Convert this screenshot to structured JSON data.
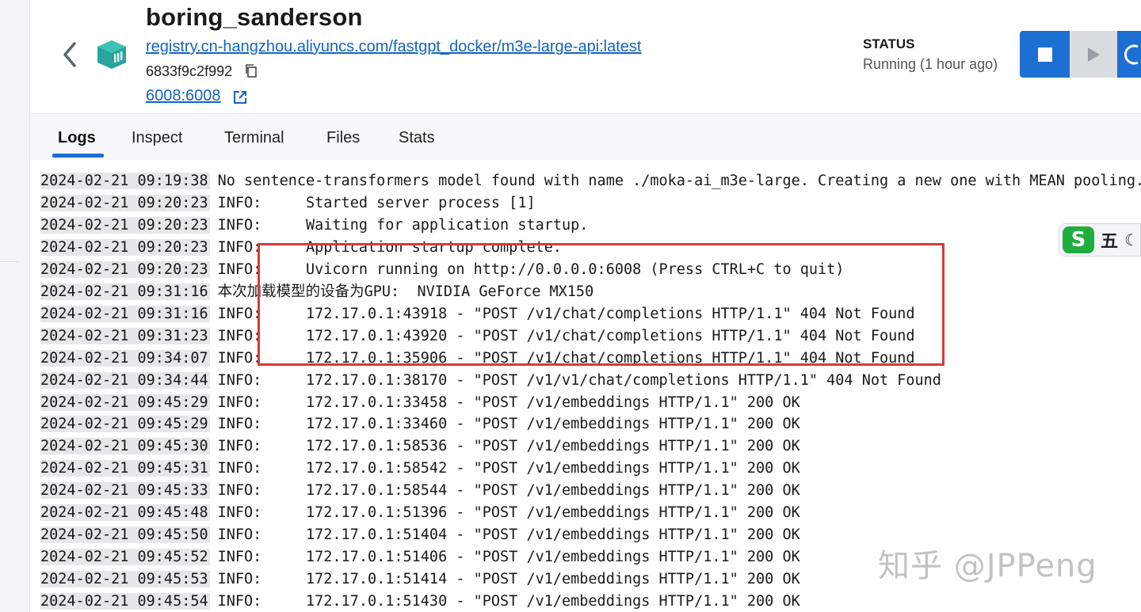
{
  "container": {
    "name": "boring_sanderson",
    "image": "registry.cn-hangzhou.aliyuncs.com/fastgpt_docker/m3e-large-api:latest",
    "id": "6833f9c2f992",
    "port": "6008:6008"
  },
  "status": {
    "label": "STATUS",
    "value": "Running (1 hour ago)"
  },
  "tabs": [
    {
      "label": "Logs",
      "active": true
    },
    {
      "label": "Inspect",
      "active": false
    },
    {
      "label": "Terminal",
      "active": false
    },
    {
      "label": "Files",
      "active": false
    },
    {
      "label": "Stats",
      "active": false
    }
  ],
  "logs": [
    {
      "ts": "2024-02-21 09:19:38",
      "msg": "No sentence-transformers model found with name ./moka-ai_m3e-large. Creating a new one with MEAN pooling."
    },
    {
      "ts": "2024-02-21 09:20:23",
      "msg": "INFO:     Started server process [1]"
    },
    {
      "ts": "2024-02-21 09:20:23",
      "msg": "INFO:     Waiting for application startup."
    },
    {
      "ts": "2024-02-21 09:20:23",
      "msg": "INFO:     Application startup complete."
    },
    {
      "ts": "2024-02-21 09:20:23",
      "msg": "INFO:     Uvicorn running on http://0.0.0.0:6008 (Press CTRL+C to quit)"
    },
    {
      "ts": "2024-02-21 09:31:16",
      "msg": "本次加载模型的设备为GPU:  NVIDIA GeForce MX150"
    },
    {
      "ts": "2024-02-21 09:31:16",
      "msg": "INFO:     172.17.0.1:43918 - \"POST /v1/chat/completions HTTP/1.1\" 404 Not Found"
    },
    {
      "ts": "2024-02-21 09:31:23",
      "msg": "INFO:     172.17.0.1:43920 - \"POST /v1/chat/completions HTTP/1.1\" 404 Not Found"
    },
    {
      "ts": "2024-02-21 09:34:07",
      "msg": "INFO:     172.17.0.1:35906 - \"POST /v1/chat/completions HTTP/1.1\" 404 Not Found"
    },
    {
      "ts": "2024-02-21 09:34:44",
      "msg": "INFO:     172.17.0.1:38170 - \"POST /v1/v1/chat/completions HTTP/1.1\" 404 Not Found"
    },
    {
      "ts": "2024-02-21 09:45:29",
      "msg": "INFO:     172.17.0.1:33458 - \"POST /v1/embeddings HTTP/1.1\" 200 OK"
    },
    {
      "ts": "2024-02-21 09:45:29",
      "msg": "INFO:     172.17.0.1:33460 - \"POST /v1/embeddings HTTP/1.1\" 200 OK"
    },
    {
      "ts": "2024-02-21 09:45:30",
      "msg": "INFO:     172.17.0.1:58536 - \"POST /v1/embeddings HTTP/1.1\" 200 OK"
    },
    {
      "ts": "2024-02-21 09:45:31",
      "msg": "INFO:     172.17.0.1:58542 - \"POST /v1/embeddings HTTP/1.1\" 200 OK"
    },
    {
      "ts": "2024-02-21 09:45:33",
      "msg": "INFO:     172.17.0.1:58544 - \"POST /v1/embeddings HTTP/1.1\" 200 OK"
    },
    {
      "ts": "2024-02-21 09:45:48",
      "msg": "INFO:     172.17.0.1:51396 - \"POST /v1/embeddings HTTP/1.1\" 200 OK"
    },
    {
      "ts": "2024-02-21 09:45:50",
      "msg": "INFO:     172.17.0.1:51404 - \"POST /v1/embeddings HTTP/1.1\" 200 OK"
    },
    {
      "ts": "2024-02-21 09:45:52",
      "msg": "INFO:     172.17.0.1:51406 - \"POST /v1/embeddings HTTP/1.1\" 200 OK"
    },
    {
      "ts": "2024-02-21 09:45:53",
      "msg": "INFO:     172.17.0.1:51414 - \"POST /v1/embeddings HTTP/1.1\" 200 OK"
    },
    {
      "ts": "2024-02-21 09:45:54",
      "msg": "INFO:     172.17.0.1:51430 - \"POST /v1/embeddings HTTP/1.1\" 200 OK"
    }
  ],
  "ime": {
    "char": "五"
  },
  "watermark": "知乎 @JPPeng",
  "colors": {
    "accent": "#1c6fd3",
    "link": "#1265c0",
    "highlight_box": "#d63a3a",
    "container_icon": "#2aa39a"
  },
  "icons": [
    "chevron-left-icon",
    "container-icon",
    "copy-icon",
    "external-link-icon",
    "stop-icon",
    "play-icon",
    "restart-icon"
  ]
}
